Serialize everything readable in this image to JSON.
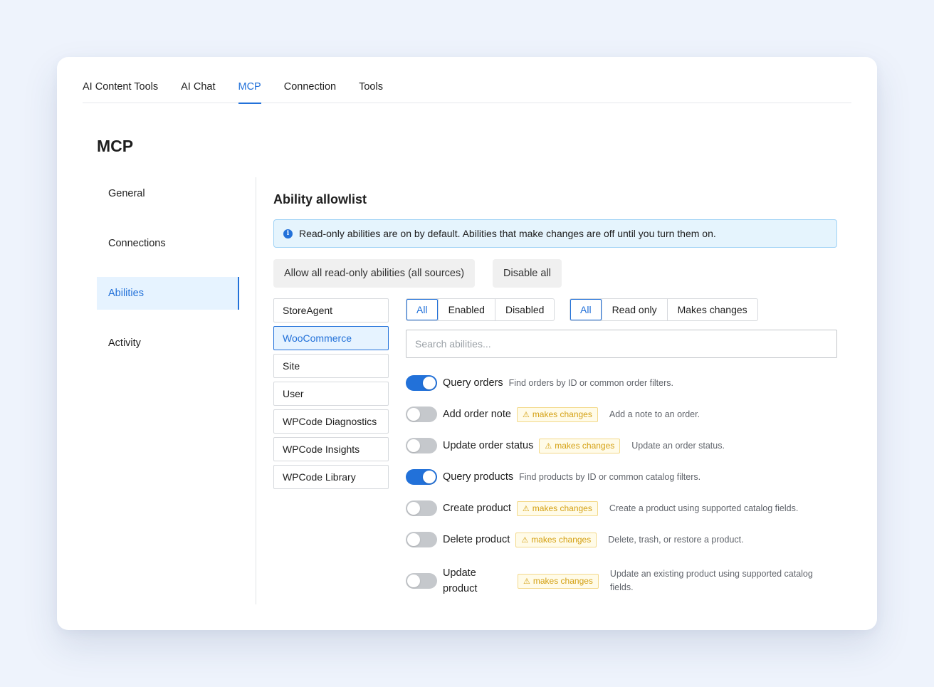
{
  "tabs": [
    {
      "label": "AI Content Tools",
      "active": false
    },
    {
      "label": "AI Chat",
      "active": false
    },
    {
      "label": "MCP",
      "active": true
    },
    {
      "label": "Connection",
      "active": false
    },
    {
      "label": "Tools",
      "active": false
    }
  ],
  "page": {
    "title": "MCP"
  },
  "sidebar": {
    "items": [
      {
        "label": "General",
        "active": false
      },
      {
        "label": "Connections",
        "active": false
      },
      {
        "label": "Abilities",
        "active": true
      },
      {
        "label": "Activity",
        "active": false
      }
    ]
  },
  "allowlist": {
    "title": "Ability allowlist",
    "notice": "Read-only abilities are on by default. Abilities that make changes are off until you turn them on.",
    "notice_icon": "info-icon",
    "allow_all_label": "Allow all read-only abilities (all sources)",
    "disable_all_label": "Disable all"
  },
  "sources": [
    {
      "label": "StoreAgent",
      "active": false
    },
    {
      "label": "WooCommerce",
      "active": true
    },
    {
      "label": "Site",
      "active": false
    },
    {
      "label": "User",
      "active": false
    },
    {
      "label": "WPCode Diagnostics",
      "active": false
    },
    {
      "label": "WPCode Insights",
      "active": false
    },
    {
      "label": "WPCode Library",
      "active": false
    }
  ],
  "filters": {
    "status": [
      {
        "label": "All",
        "active": true
      },
      {
        "label": "Enabled",
        "active": false
      },
      {
        "label": "Disabled",
        "active": false
      }
    ],
    "type": [
      {
        "label": "All",
        "active": true
      },
      {
        "label": "Read only",
        "active": false
      },
      {
        "label": "Makes changes",
        "active": false
      }
    ]
  },
  "search": {
    "placeholder": "Search abilities...",
    "value": ""
  },
  "badge_label": "makes changes",
  "badge_icon": "warning-icon",
  "colors": {
    "accent": "#2271d9",
    "badge_text": "#d4a012",
    "notice_bg": "#e5f4fd"
  },
  "abilities": [
    {
      "name": "Query orders",
      "enabled": true,
      "makes_changes": false,
      "description": "Find orders by ID or common order filters."
    },
    {
      "name": "Add order note",
      "enabled": false,
      "makes_changes": true,
      "description": "Add a note to an order."
    },
    {
      "name": "Update order status",
      "enabled": false,
      "makes_changes": true,
      "description": "Update an order status."
    },
    {
      "name": "Query products",
      "enabled": true,
      "makes_changes": false,
      "description": "Find products by ID or common catalog filters."
    },
    {
      "name": "Create product",
      "enabled": false,
      "makes_changes": true,
      "description": "Create a product using supported catalog fields."
    },
    {
      "name": "Delete product",
      "enabled": false,
      "makes_changes": true,
      "description": "Delete, trash, or restore a product."
    },
    {
      "name": "Update product",
      "enabled": false,
      "makes_changes": true,
      "description": "Update an existing product using supported catalog fields."
    }
  ]
}
